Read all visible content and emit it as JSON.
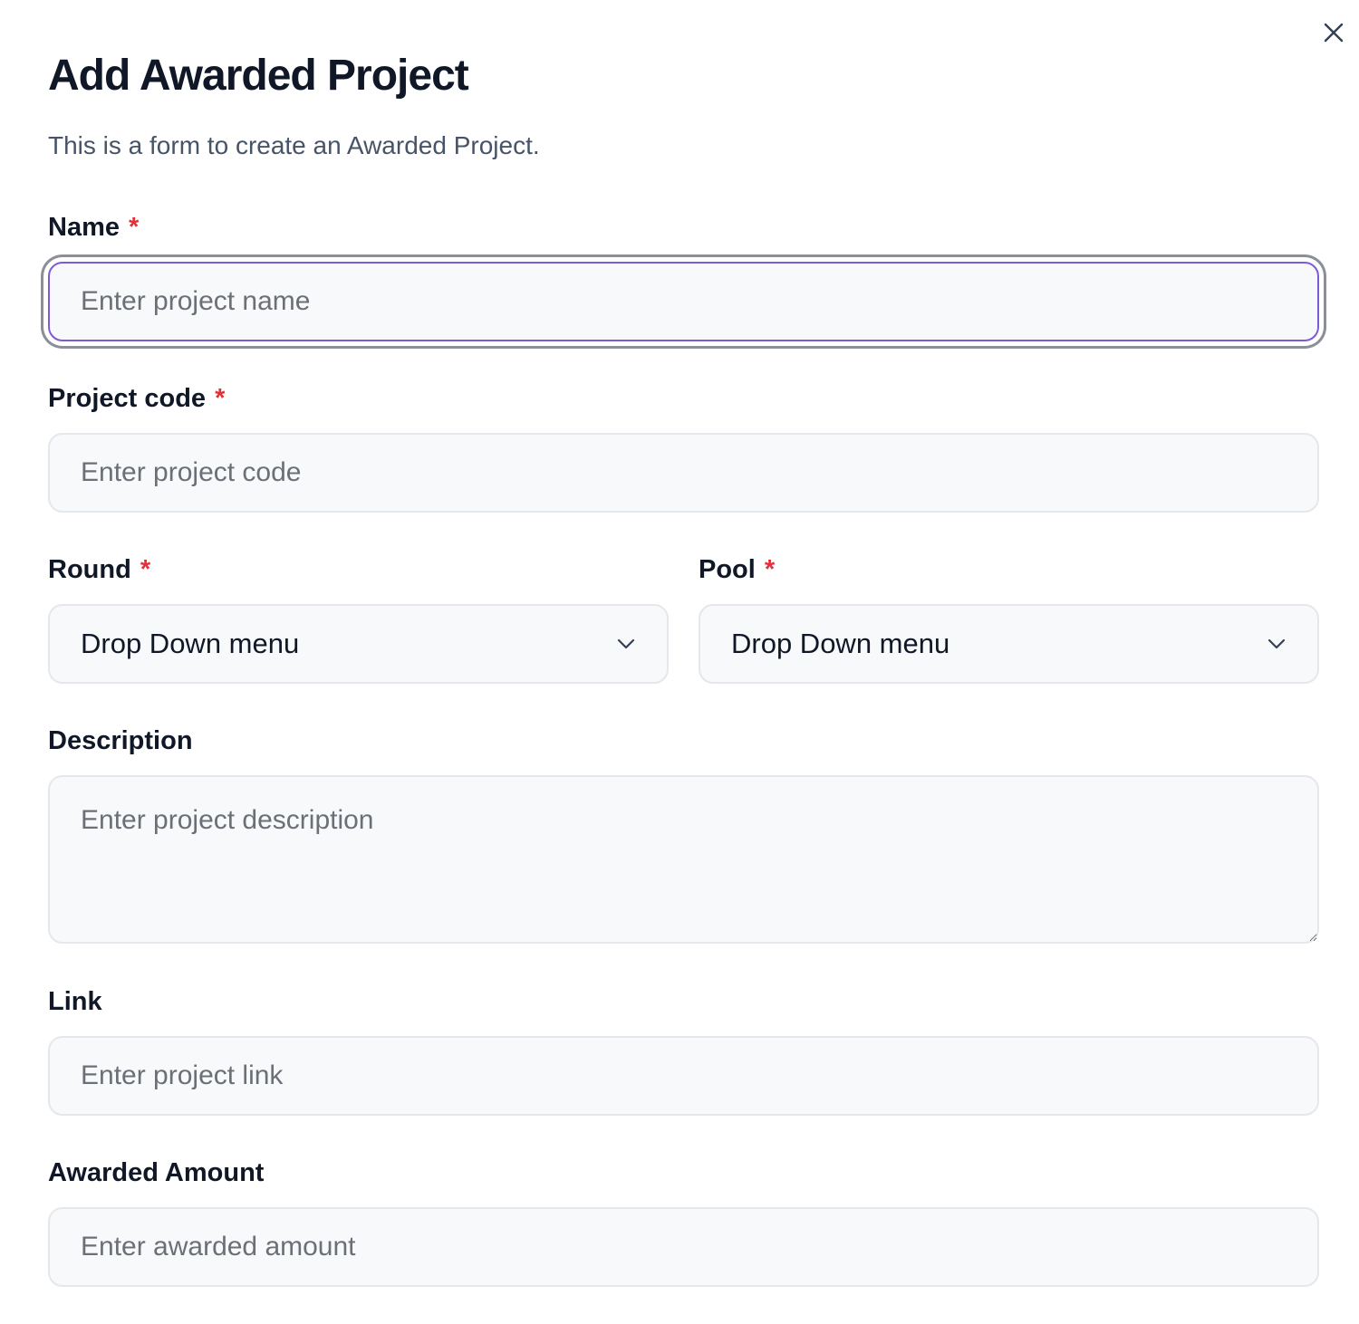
{
  "dialog": {
    "title": "Add Awarded Project",
    "subtitle": "This is a form to create an Awarded Project.",
    "close_icon": "close-icon"
  },
  "fields": {
    "name": {
      "label": "Name",
      "required": "*",
      "placeholder": "Enter project name",
      "value": ""
    },
    "project_code": {
      "label": "Project code",
      "required": "*",
      "placeholder": "Enter project code",
      "value": ""
    },
    "round": {
      "label": "Round",
      "required": "*",
      "selected": "Drop Down menu",
      "icon": "chevron-down-icon"
    },
    "pool": {
      "label": "Pool",
      "required": "*",
      "selected": "Drop Down menu",
      "icon": "chevron-down-icon"
    },
    "description": {
      "label": "Description",
      "placeholder": "Enter project description",
      "value": ""
    },
    "link": {
      "label": "Link",
      "placeholder": "Enter project link",
      "value": ""
    },
    "awarded_amount": {
      "label": "Awarded Amount",
      "placeholder": "Enter awarded amount",
      "value": ""
    }
  },
  "colors": {
    "text": "#101828",
    "muted": "#475467",
    "required": "#e5303a",
    "focus_border": "#7c5cd6",
    "field_bg": "#f8f9fb",
    "field_border": "#e4e7ec"
  }
}
